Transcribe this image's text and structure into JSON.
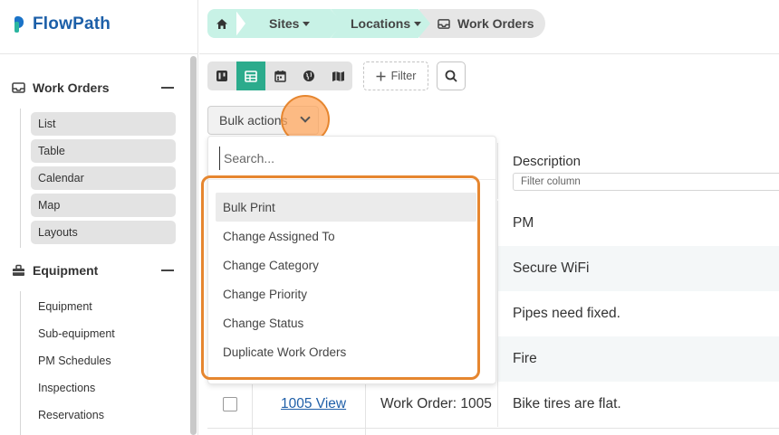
{
  "app": {
    "name": "FlowPath"
  },
  "colors": {
    "accent": "#2bab8c",
    "breadcrumb_bg": "#c8f2e6",
    "highlight": "#e6862f",
    "link": "#1f5fa8",
    "logo": "#1c5fa8"
  },
  "sidebar": {
    "sections": [
      {
        "label": "Work Orders",
        "icon": "inbox-icon",
        "items": [
          "List",
          "Table",
          "Calendar",
          "Map",
          "Layouts"
        ]
      },
      {
        "label": "Equipment",
        "icon": "toolbox-icon",
        "items": [
          "Equipment",
          "Sub-equipment",
          "PM Schedules",
          "Inspections",
          "Reservations"
        ]
      }
    ]
  },
  "breadcrumb": {
    "home_icon": "home-icon",
    "sites": "Sites",
    "locations": "Locations",
    "current": "Work Orders",
    "current_icon": "inbox-icon"
  },
  "toolbar": {
    "views": [
      "kanban-icon",
      "table-icon",
      "calendar-icon",
      "globe-icon",
      "map-icon"
    ],
    "active_view": "table-icon",
    "filter_label": "Filter",
    "search_icon": "search-icon"
  },
  "bulk_actions": {
    "label": "Bulk actions",
    "search_placeholder": "Search...",
    "options": [
      "Bulk Print",
      "Change Assigned To",
      "Change Category",
      "Change Priority",
      "Change Status",
      "Duplicate Work Orders"
    ],
    "hovered": "Bulk Print"
  },
  "table": {
    "description_header": "Description",
    "filter_placeholder": "Filter column",
    "descriptions": [
      "PM",
      "Secure WiFi",
      "Pipes need fixed.",
      "Fire",
      "Bike tires are flat."
    ],
    "visible_row": {
      "view_link": "1005 View",
      "work_order": "Work Order: 1005"
    }
  }
}
